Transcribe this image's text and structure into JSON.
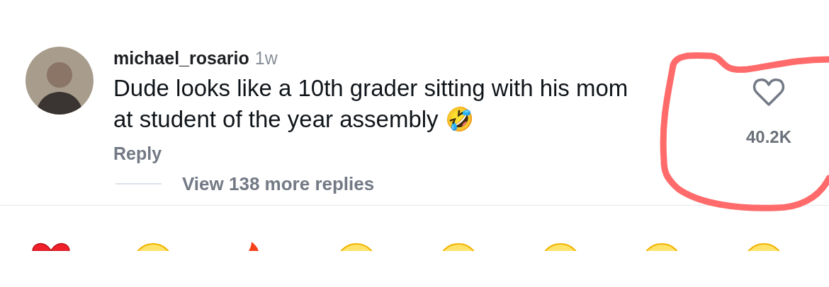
{
  "comment": {
    "username": "michael_rosario",
    "time": "1w",
    "text": "Dude looks like a 10th grader sitting with his mom at student of the year assembly 🤣",
    "reply_label": "Reply",
    "liked": false,
    "like_count": "40.2K"
  },
  "view_replies": "View 138 more replies",
  "emoji_bar": [
    {
      "kind": "heart"
    },
    {
      "kind": "face"
    },
    {
      "kind": "fire"
    },
    {
      "kind": "face"
    },
    {
      "kind": "face"
    },
    {
      "kind": "face"
    },
    {
      "kind": "face"
    },
    {
      "kind": "face"
    }
  ]
}
